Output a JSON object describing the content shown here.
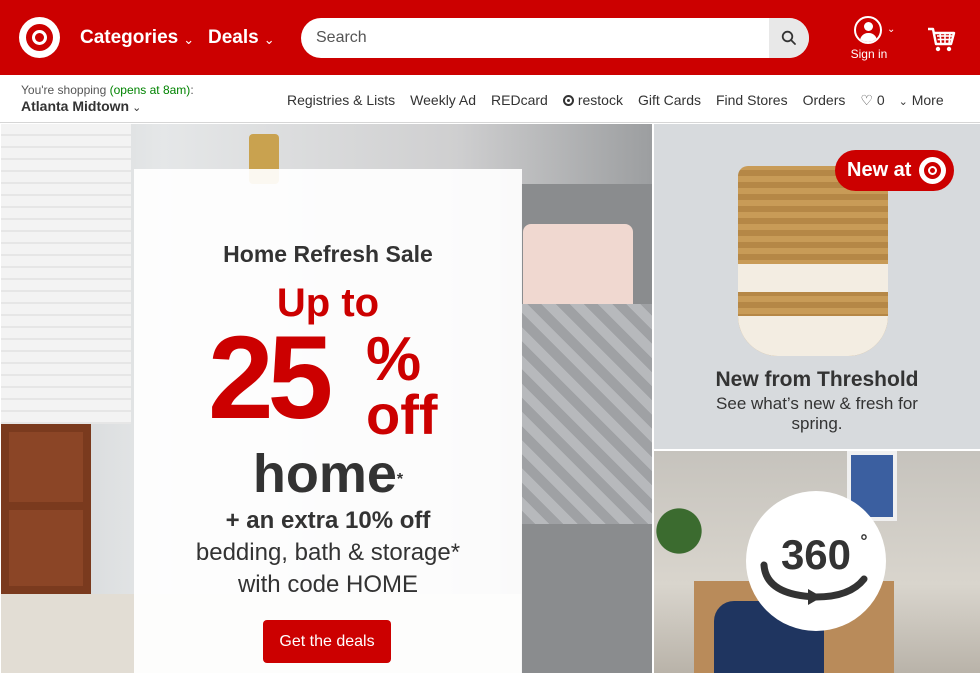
{
  "header": {
    "nav": {
      "categories": "Categories",
      "deals": "Deals"
    },
    "search": {
      "placeholder": "Search"
    },
    "sign_in": "Sign in"
  },
  "subbar": {
    "store_prefix": "You're shopping ",
    "store_hours": "(opens at 8am)",
    "store_suffix": ":",
    "store_name": "Atlanta Midtown",
    "links": [
      "Registries & Lists",
      "Weekly Ad",
      "REDcard",
      "restock",
      "Gift Cards",
      "Find Stores",
      "Orders"
    ],
    "favorites_count": "0",
    "more": "More"
  },
  "hero": {
    "eyebrow": "Home Refresh Sale",
    "upto": "Up to",
    "amount": "25",
    "percent": "%",
    "off": "off",
    "category": "home",
    "asterisk": "*",
    "extra": "+ an extra 10% off",
    "line2": "bedding, bath & storage*",
    "line3": "with code HOME",
    "cta": "Get the deals"
  },
  "tile_new": {
    "badge": "New at",
    "title": "New from Threshold",
    "subtitle": "See what’s new & fresh for spring."
  },
  "tile_360": {
    "badge": "360",
    "degree": "°"
  },
  "colors": {
    "brand_red": "#cc0000",
    "text": "#333333",
    "open_green": "#008300"
  }
}
